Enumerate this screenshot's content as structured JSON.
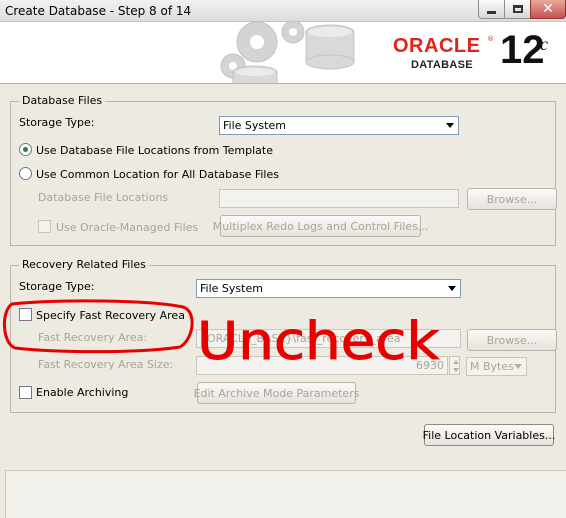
{
  "window": {
    "title": "Create Database - Step 8 of 14"
  },
  "header": {
    "brand": "ORACLE",
    "brand_registered": "®",
    "product": "DATABASE",
    "version": "12",
    "version_suffix": "c"
  },
  "database_files": {
    "legend": "Database Files",
    "storage_type_label": "Storage Type:",
    "storage_type_value": "File System",
    "use_template_label": "Use Database File Locations from Template",
    "use_template_selected": true,
    "use_common_label": "Use Common Location for All Database Files",
    "use_common_selected": false,
    "file_locations_label": "Database File Locations",
    "file_locations_value": "",
    "browse_label": "Browse...",
    "oracle_managed_label": "Use Oracle-Managed Files",
    "oracle_managed_checked": false,
    "multiplex_label": "Multiplex Redo Logs and Control Files..."
  },
  "recovery_files": {
    "legend": "Recovery Related Files",
    "storage_type_label": "Storage Type:",
    "storage_type_value": "File System",
    "specify_fra_label": "Specify Fast Recovery Area",
    "specify_fra_checked": false,
    "fra_label": "Fast Recovery Area:",
    "fra_value": "{ORACLE_BASE}\\fast_recovery_area",
    "browse_label": "Browse...",
    "fra_size_label": "Fast Recovery Area Size:",
    "fra_size_value": "6930",
    "fra_size_unit": "M Bytes",
    "enable_archiving_label": "Enable Archiving",
    "enable_archiving_checked": false,
    "archive_params_label": "Edit Archive Mode Parameters"
  },
  "file_location_variables_label": "File Location Variables...",
  "annotation": {
    "text": "Uncheck",
    "color": "#e60000"
  }
}
